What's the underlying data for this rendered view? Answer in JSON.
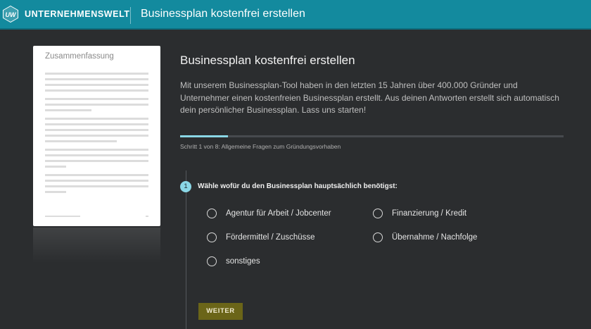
{
  "header": {
    "logo_text": "UW",
    "brand": "UNTERNEHMENSWELT",
    "title": "Businessplan kostenfrei erstellen"
  },
  "document_preview": {
    "title": "Zusammenfassung"
  },
  "main": {
    "title": "Businessplan kostenfrei erstellen",
    "intro": "Mit unserem Businessplan-Tool haben in den letzten 15 Jahren über 400.000 Gründer und Unternehmer einen kostenfreien Businessplan erstellt. Aus deinen Antworten erstellt sich automatisch dein persönlicher Businessplan. Lass uns starten!",
    "progress": {
      "current_step": 1,
      "total_steps": 8,
      "fraction": 0.125
    },
    "step_text": "Schritt 1 von 8: Allgemeine Fragen zum Gründungsvorhaben"
  },
  "question": {
    "number": "1",
    "text": "Wähle wofür du den Businessplan hauptsächlich benötigst:",
    "options": [
      "Agentur für Arbeit / Jobcenter",
      "Finanzierung / Kredit",
      "Fördermittel / Zuschüsse",
      "Übernahme / Nachfolge",
      "sonstiges"
    ]
  },
  "actions": {
    "next_label": "WEITER"
  },
  "colors": {
    "header_bg": "#138a9e",
    "page_bg": "#2b2d2f",
    "accent": "#8ad7e6",
    "button_bg": "#6b6518"
  }
}
